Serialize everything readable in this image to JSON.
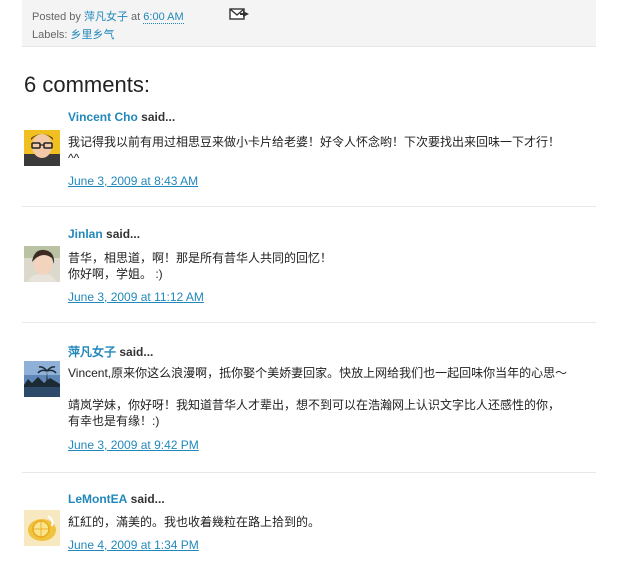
{
  "post_footer": {
    "posted_by_label": "Posted by",
    "author": "萍凡女子",
    "at_label": "at",
    "time": "6:00 AM",
    "labels_label": "Labels:",
    "label": "乡里乡气",
    "email_icon": "email-post-icon"
  },
  "comments_title": "6 comments:",
  "said_label": "said...",
  "comments": [
    {
      "author": "Vincent Cho",
      "avatar": "avatar-man-glasses",
      "lines": [
        "我记得我以前有用过相思豆来做小卡片给老婆！好令人怀念哟！下次要找出来回味一下才行！",
        "^^"
      ],
      "timestamp": "June 3, 2009 at 8:43 AM"
    },
    {
      "author": "Jinlan",
      "avatar": "avatar-woman",
      "lines": [
        "昔华，相思道，啊！那是所有昔华人共同的回忆！",
        "你好啊，学姐。 :)"
      ],
      "timestamp": "June 3, 2009 at 11:12 AM"
    },
    {
      "author": "萍凡女子",
      "avatar": "avatar-beach-sunset",
      "lines": [
        "Vincent,原来你这么浪漫啊，抵你娶个美娇妻回家。快放上网给我们也一起回味你当年的心思～",
        "",
        "靖岚学妹，你好呀！我知道昔华人才辈出，想不到可以在浩瀚网上认识文字比人还感性的你，",
        "有幸也是有缘！:)"
      ],
      "timestamp": "June 3, 2009 at 9:42 PM"
    },
    {
      "author": "LeMontEA",
      "avatar": "avatar-lemon-tea",
      "lines": [
        "紅紅的，滿美的。我也收着幾粒在路上拾到的。"
      ],
      "timestamp": "June 4, 2009 at 1:34 PM"
    }
  ]
}
